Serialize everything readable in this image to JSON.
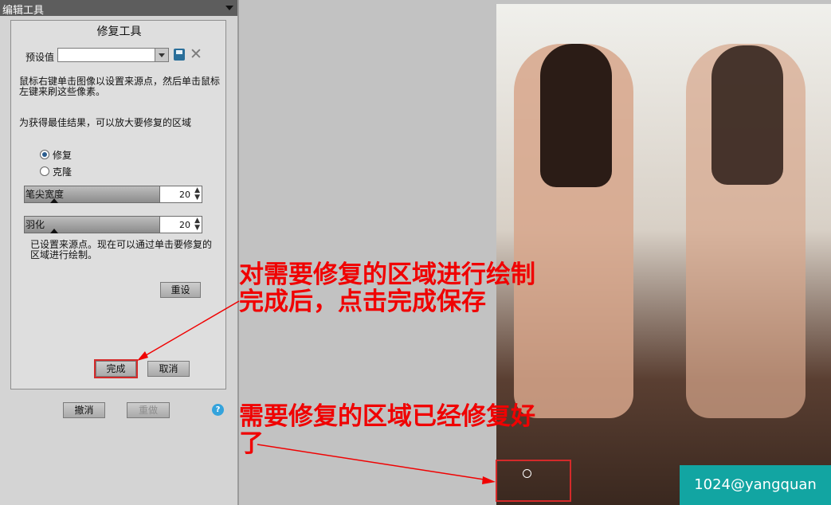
{
  "panel": {
    "header_title": "编辑工具",
    "tool_title": "修复工具",
    "preset_label": "预设值",
    "preset_value": "",
    "hint_line1": "鼠标右键单击图像以设置来源点，然后单击鼠标左键来刷这些像素。",
    "hint_line2": "为获得最佳结果，可以放大要修复的区域",
    "mode_options": [
      {
        "label": "修复",
        "selected": true
      },
      {
        "label": "克隆",
        "selected": false
      }
    ],
    "brush_width": {
      "label": "笔尖宽度",
      "value": "20"
    },
    "feather": {
      "label": "羽化",
      "value": "20"
    },
    "status_text": "已设置来源点。现在可以通过单击要修复的区域进行绘制。",
    "reset_button": "重设",
    "done_button": "完成",
    "cancel_button": "取消",
    "undo_button": "撤消",
    "redo_button": "重做",
    "help_glyph": "?"
  },
  "annotations": {
    "top_line1": "对需要修复的区域进行绘制",
    "top_line2": "完成后，点击完成保存",
    "bottom_line1": "需要修复的区域已经修复好",
    "bottom_line2": "了"
  },
  "watermark": "1024@yangquan",
  "colors": {
    "annotation_red": "#f00202",
    "watermark_bg": "#12a5a2",
    "panel_bg": "#d4d4d4",
    "workspace_bg": "#c2c2c2"
  },
  "icons": [
    "panel-menu-arrow-icon",
    "save-preset-icon",
    "delete-preset-icon",
    "help-icon"
  ]
}
